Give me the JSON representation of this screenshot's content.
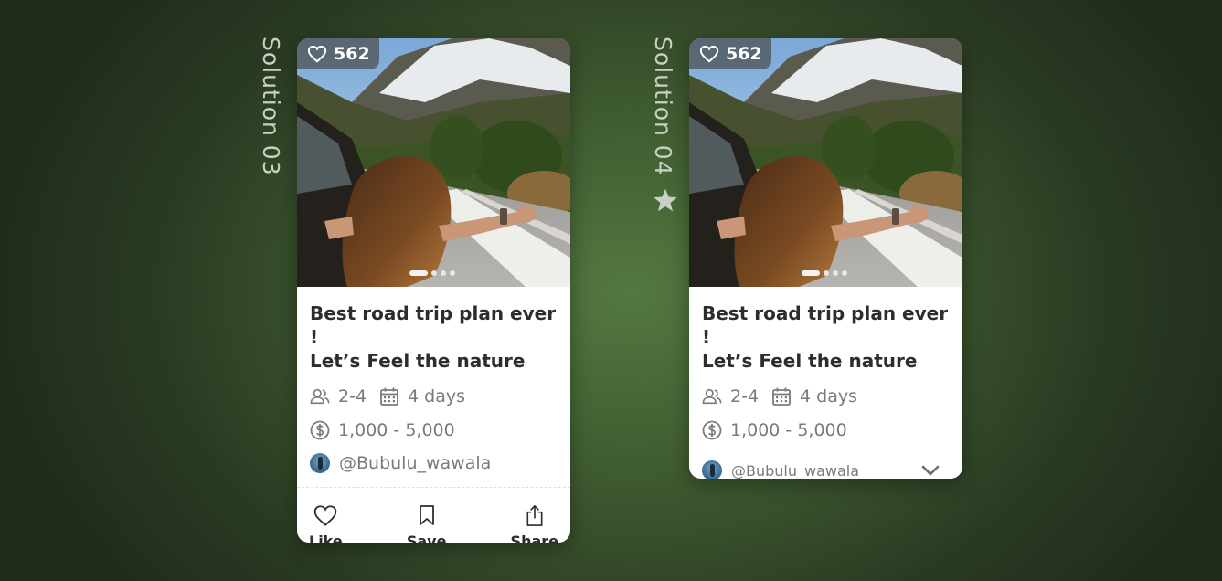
{
  "solutions": [
    {
      "label": "Solution 03",
      "starred": false,
      "likes": "562",
      "title_line1": "Best road trip plan ever !",
      "title_line2": "Let’s Feel the nature",
      "people": "2-4",
      "duration": "4 days",
      "budget": "1,000 -  5,000",
      "username": "@Bubulu_wawala",
      "actions": {
        "like": "Like",
        "save": "Save",
        "share": "Share"
      },
      "carousel": {
        "total": 4,
        "active": 1
      }
    },
    {
      "label": "Solution 04",
      "starred": true,
      "likes": "562",
      "title_line1": "Best road trip plan ever !",
      "title_line2": "Let’s Feel the nature",
      "people": "2-4",
      "duration": "4 days",
      "budget": "1,000 -  5,000",
      "username": "@Bubulu_wawala",
      "carousel": {
        "total": 4,
        "active": 1
      }
    }
  ],
  "icons": {
    "likes": "heart-icon",
    "people": "people-icon",
    "duration": "calendar-icon",
    "budget": "dollar-circle-icon",
    "like": "heart-icon",
    "save": "bookmark-icon",
    "share": "share-icon",
    "expand": "chevron-down-icon",
    "starred": "star-icon"
  },
  "colors": {
    "background": "#3e5a30",
    "card": "#ffffff",
    "title_text": "#2d2d2d",
    "meta_text": "#7a7a7a",
    "label_text": "#c9d0c4"
  }
}
